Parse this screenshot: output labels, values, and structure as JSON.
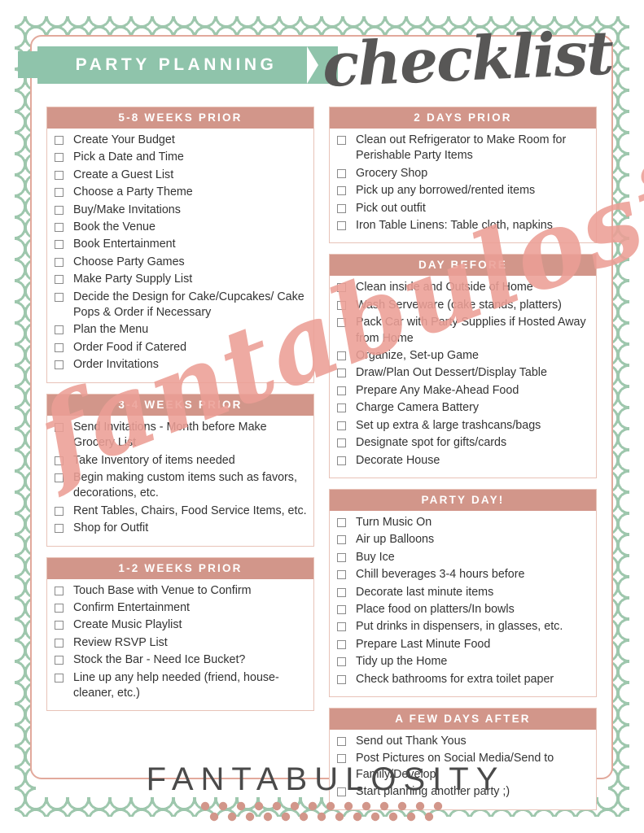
{
  "header": {
    "banner_title": "PARTY PLANNING",
    "script_title": "checklist"
  },
  "watermark": {
    "text": "fantabulosity",
    "color": "#ec9f96"
  },
  "footer": {
    "brand": "FANTABULOSITY"
  },
  "theme": {
    "header_pink": "#d2968a",
    "banner_green": "#8fc4ab",
    "card_border": "#e2a99c",
    "lattice_green": "#9ec7ad",
    "text_dark": "#333333",
    "script_gray": "#585756"
  },
  "left_column": [
    {
      "title": "5-8 WEEKS PRIOR",
      "items": [
        "Create Your Budget",
        "Pick a Date and Time",
        "Create a Guest List",
        "Choose a Party Theme",
        "Buy/Make Invitations",
        "Book the Venue",
        "Book Entertainment",
        "Choose Party Games",
        "Make Party Supply List",
        "Decide the Design for Cake/Cupcakes/ Cake Pops & Order if Necessary",
        "Plan the Menu",
        "Order Food if Catered",
        "Order Invitations"
      ]
    },
    {
      "title": "3-4 WEEKS PRIOR",
      "items": [
        "Send Invitations - Month before Make Grocery List",
        "Take Inventory of items needed",
        "Begin making custom items such as favors, decorations, etc.",
        "Rent Tables, Chairs, Food Service Items, etc.",
        "Shop for Outfit"
      ]
    },
    {
      "title": "1-2 WEEKS PRIOR",
      "items": [
        "Touch Base with Venue to Confirm",
        "Confirm Entertainment",
        "Create Music Playlist",
        "Review RSVP List",
        "Stock the Bar - Need Ice Bucket?",
        "Line up any help needed (friend, house-cleaner, etc.)"
      ]
    }
  ],
  "right_column": [
    {
      "title": "2 DAYS PRIOR",
      "items": [
        "Clean out Refrigerator to Make Room for Perishable Party Items",
        "Grocery Shop",
        "Pick up any borrowed/rented items",
        "Pick out outfit",
        "Iron Table Linens: Table cloth, napkins"
      ]
    },
    {
      "title": "DAY BEFORE",
      "items": [
        "Clean inside and Outside of Home",
        "Wash Serveware (cake stands, platters)",
        "Pack Car with Party Supplies if Hosted Away from Home",
        "Organize, Set-up Game",
        "Draw/Plan Out Dessert/Display Table",
        "Prepare Any Make-Ahead Food",
        "Charge Camera Battery",
        "Set up extra & large trashcans/bags",
        "Designate spot for gifts/cards",
        "Decorate House"
      ]
    },
    {
      "title": "PARTY DAY!",
      "items": [
        "Turn Music On",
        "Air up Balloons",
        "Buy Ice",
        "Chill beverages 3-4 hours before",
        " Decorate last minute items",
        "Place food on platters/In bowls",
        "Put drinks in dispensers, in glasses, etc.",
        "Prepare Last Minute Food",
        "Tidy up the Home",
        "Check bathrooms for extra toilet paper"
      ]
    },
    {
      "title": "A FEW DAYS AFTER",
      "items": [
        "Send out Thank Yous",
        "Post Pictures on Social Media/Send to Family/Develop",
        "Start planning another party ;)"
      ]
    }
  ]
}
